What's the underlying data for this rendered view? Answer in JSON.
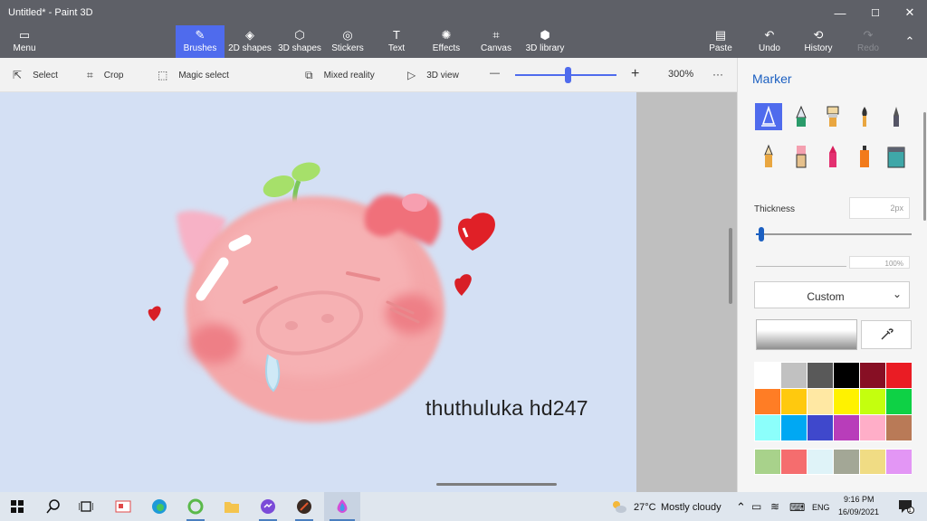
{
  "app": {
    "title": "Untitled* - Paint 3D"
  },
  "window_controls": {
    "minimize": "—",
    "maximize": "☐",
    "close": "✕"
  },
  "ribbon": {
    "menu": "Menu",
    "tabs": [
      {
        "label": "Brushes",
        "icon": "brush-icon",
        "glyph": "✎"
      },
      {
        "label": "2D shapes",
        "icon": "2d-shapes-icon",
        "glyph": "◈"
      },
      {
        "label": "3D shapes",
        "icon": "3d-shapes-icon",
        "glyph": "⬡"
      },
      {
        "label": "Stickers",
        "icon": "stickers-icon",
        "glyph": "◎"
      },
      {
        "label": "Text",
        "icon": "text-icon",
        "glyph": "T"
      },
      {
        "label": "Effects",
        "icon": "effects-icon",
        "glyph": "✺"
      },
      {
        "label": "Canvas",
        "icon": "canvas-icon",
        "glyph": "⌗"
      },
      {
        "label": "3D library",
        "icon": "3d-library-icon",
        "glyph": "⬢"
      }
    ],
    "paste": "Paste",
    "undo": "Undo",
    "history": "History",
    "redo": "Redo"
  },
  "toolbar": {
    "select": "Select",
    "crop": "Crop",
    "magic_select": "Magic select",
    "mixed_reality": "Mixed reality",
    "view_3d": "3D view",
    "zoom_out": "—",
    "zoom_in": "+",
    "zoom_level": "300%",
    "zoom_fraction": 0.52,
    "more": "···"
  },
  "canvas": {
    "signature_text": "thuthuluka hd247",
    "background_color": "#d4e0f4"
  },
  "panel": {
    "title": "Marker",
    "brushes": [
      {
        "name": "marker",
        "selected": true
      },
      {
        "name": "calligraphy-pen"
      },
      {
        "name": "oil-brush"
      },
      {
        "name": "watercolor"
      },
      {
        "name": "pixel-pen"
      },
      {
        "name": "pencil"
      },
      {
        "name": "eraser"
      },
      {
        "name": "crayon"
      },
      {
        "name": "spray-can"
      },
      {
        "name": "fill"
      }
    ],
    "thickness_label": "Thickness",
    "thickness_value": "2px",
    "thickness_fraction": 0.02,
    "opacity_value": "100%",
    "finish_label": "Custom",
    "colors_row1": [
      "#ffffff",
      "#c1c1c1",
      "#595959",
      "#000000",
      "#870f24",
      "#ea1c24"
    ],
    "colors_row2": [
      "#ff7d25",
      "#ffc90e",
      "#ffe8a3",
      "#fff200",
      "#c4ff0e",
      "#0ed145"
    ],
    "colors_row3": [
      "#8cfffb",
      "#00a8f3",
      "#3f48cc",
      "#b83dba",
      "#ffaec8",
      "#b97a57"
    ],
    "colors_row4": [
      "#a8d28b",
      "#f56d6e",
      "#dff3f8",
      "#a3a796",
      "#f0dc84",
      "#e396f5"
    ]
  },
  "taskbar": {
    "weather_temp": "27°C",
    "weather_desc": "Mostly cloudy",
    "language": "ENG",
    "time": "9:16 PM",
    "date": "16/09/2021",
    "notification_count": "1"
  }
}
